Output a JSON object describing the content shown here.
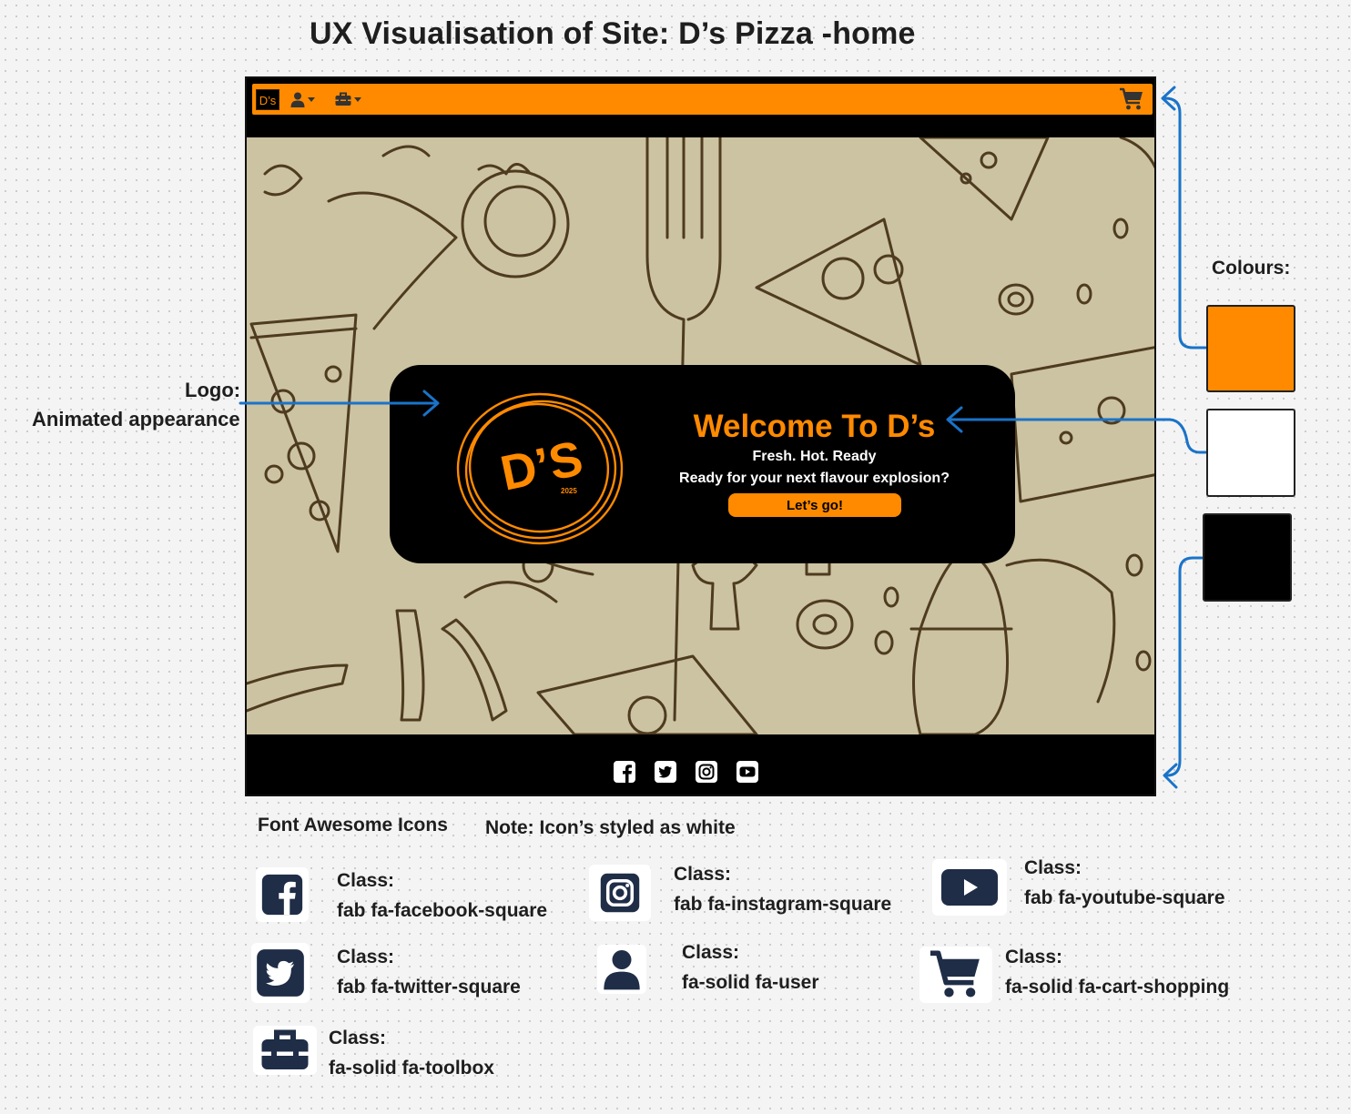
{
  "board": {
    "title": "UX Visualisation of Site: D’s Pizza -home",
    "logo_note_label": "Logo:",
    "logo_note_desc": "Animated appearance",
    "colours_label": "Colours:",
    "colours": [
      "#ff8a00",
      "#ffffff",
      "#000000"
    ],
    "arrow_color": "#1a73c9"
  },
  "site": {
    "navbar": {
      "brand": "D’s",
      "bg_color": "#ff8a00",
      "items": [
        {
          "icon": "user-icon",
          "dropdown": true
        },
        {
          "icon": "toolbox-icon",
          "dropdown": true
        }
      ],
      "cart_icon": "cart-icon"
    },
    "hero": {
      "title": "Welcome To D’s",
      "tagline": "Fresh. Hot. Ready",
      "subtitle": "Ready for your next flavour explosion?",
      "cta": "Let’s go!",
      "logo_text": "D’S",
      "logo_year": "2025"
    },
    "footer": {
      "social_icons": [
        "facebook-icon",
        "twitter-icon",
        "instagram-icon",
        "youtube-icon"
      ]
    }
  },
  "icons_legend": {
    "heading": "Font Awesome Icons",
    "note": "Note: Icon’s styled as white",
    "class_label": "Class:",
    "items": [
      {
        "icon": "facebook-square-icon",
        "class": "fab fa-facebook-square"
      },
      {
        "icon": "instagram-square-icon",
        "class": "fab fa-instagram-square"
      },
      {
        "icon": "youtube-square-icon",
        "class": "fab fa-youtube-square"
      },
      {
        "icon": "twitter-square-icon",
        "class": "fab fa-twitter-square"
      },
      {
        "icon": "user-icon",
        "class": "fa-solid fa-user"
      },
      {
        "icon": "cart-shopping-icon",
        "class": "fa-solid fa-cart-shopping"
      },
      {
        "icon": "toolbox-icon",
        "class": "fa-solid fa-toolbox"
      }
    ]
  }
}
